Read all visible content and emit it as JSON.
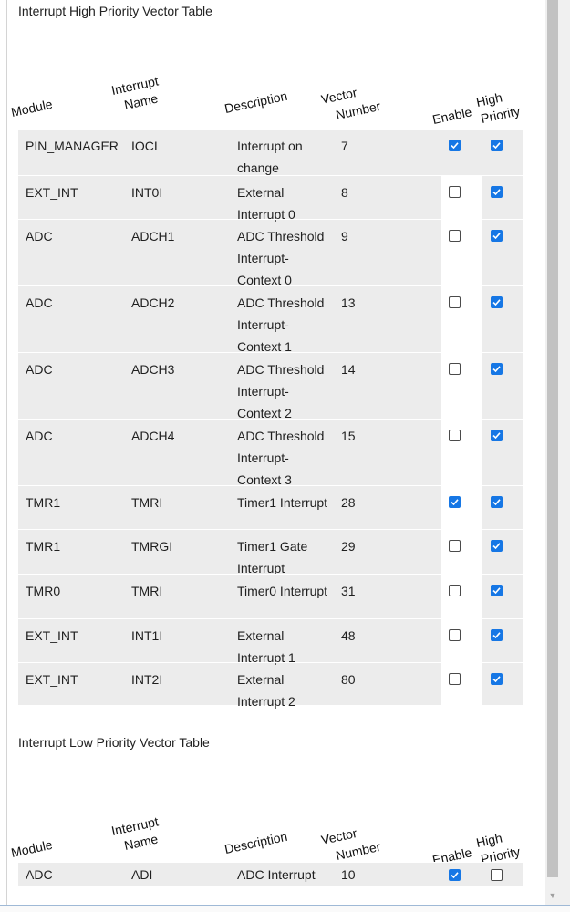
{
  "high_table": {
    "title": "Interrupt High Priority Vector Table",
    "headers": {
      "module": "Module",
      "interrupt_name_1": "Interrupt",
      "interrupt_name_2": "Name",
      "description": "Description",
      "vector_1": "Vector",
      "vector_2": "Number",
      "enable": "Enable",
      "high_1": "High",
      "high_2": "Priority"
    },
    "rows": [
      {
        "module": "PIN_MANAGER",
        "name": "IOCI",
        "description": "Interrupt on change",
        "vector": "7",
        "enable": true,
        "high": true
      },
      {
        "module": "EXT_INT",
        "name": "INT0I",
        "description": "External Interrupt 0",
        "vector": "8",
        "enable": false,
        "high": true
      },
      {
        "module": "ADC",
        "name": "ADCH1",
        "description": "ADC Threshold Interrupt-Context 0",
        "vector": "9",
        "enable": false,
        "high": true
      },
      {
        "module": "ADC",
        "name": "ADCH2",
        "description": "ADC Threshold Interrupt-Context 1",
        "vector": "13",
        "enable": false,
        "high": true
      },
      {
        "module": "ADC",
        "name": "ADCH3",
        "description": "ADC Threshold Interrupt-Context 2",
        "vector": "14",
        "enable": false,
        "high": true
      },
      {
        "module": "ADC",
        "name": "ADCH4",
        "description": "ADC Threshold Interrupt-Context 3",
        "vector": "15",
        "enable": false,
        "high": true
      },
      {
        "module": "TMR1",
        "name": "TMRI",
        "description": "Timer1 Interrupt",
        "vector": "28",
        "enable": true,
        "high": true
      },
      {
        "module": "TMR1",
        "name": "TMRGI",
        "description": "Timer1 Gate Interrupt",
        "vector": "29",
        "enable": false,
        "high": true
      },
      {
        "module": "TMR0",
        "name": "TMRI",
        "description": "Timer0 Interrupt",
        "vector": "31",
        "enable": false,
        "high": true
      },
      {
        "module": "EXT_INT",
        "name": "INT1I",
        "description": "External Interrupt 1",
        "vector": "48",
        "enable": false,
        "high": true
      },
      {
        "module": "EXT_INT",
        "name": "INT2I",
        "description": "External Interrupt 2",
        "vector": "80",
        "enable": false,
        "high": true
      }
    ]
  },
  "low_table": {
    "title": "Interrupt Low Priority Vector Table",
    "headers": {
      "module": "Module",
      "interrupt_name_1": "Interrupt",
      "interrupt_name_2": "Name",
      "description": "Description",
      "vector_1": "Vector",
      "vector_2": "Number",
      "enable": "Enable",
      "high_1": "High",
      "high_2": "Priority"
    },
    "rows": [
      {
        "module": "ADC",
        "name": "ADI",
        "description": "ADC Interrupt",
        "vector": "10",
        "enable": true,
        "high": false
      }
    ]
  },
  "colors": {
    "checkbox_checked": "#1677e5",
    "row_background": "#ececec",
    "scrollbar_thumb": "#c2c2c2"
  },
  "icons": {
    "scroll_down": "scroll-down-arrow-icon",
    "check": "checkmark-icon"
  }
}
